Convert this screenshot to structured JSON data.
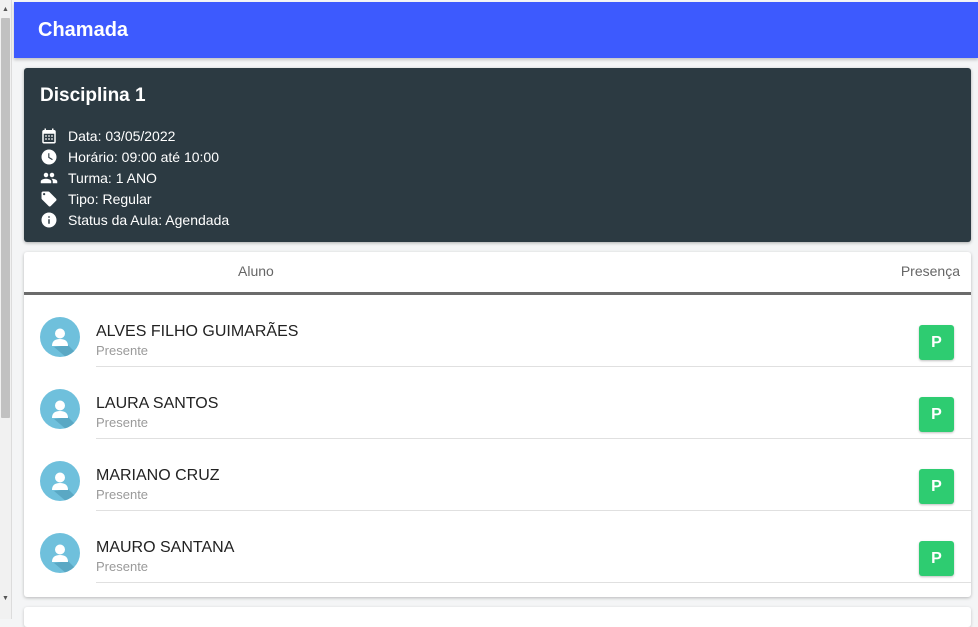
{
  "app": {
    "title": "Chamada"
  },
  "class_info": {
    "title": "Disciplina 1",
    "details": [
      {
        "icon": "calendar-icon",
        "text": "Data: 03/05/2022"
      },
      {
        "icon": "clock-icon",
        "text": "Horário: 09:00 até 10:00"
      },
      {
        "icon": "people-icon",
        "text": "Turma: 1 ANO"
      },
      {
        "icon": "tag-icon",
        "text": "Tipo: Regular"
      },
      {
        "icon": "info-icon",
        "text": "Status da Aula: Agendada"
      }
    ]
  },
  "table": {
    "headers": {
      "student": "Aluno",
      "presence": "Presença"
    },
    "rows": [
      {
        "name": "ALVES FILHO GUIMARÃES",
        "status": "Presente",
        "button": "P"
      },
      {
        "name": "LAURA SANTOS",
        "status": "Presente",
        "button": "P"
      },
      {
        "name": "MARIANO CRUZ",
        "status": "Presente",
        "button": "P"
      },
      {
        "name": "MAURO SANTANA",
        "status": "Presente",
        "button": "P"
      }
    ]
  },
  "colors": {
    "appbar": "#3d5afe",
    "info_card": "#2c3a42",
    "present_button": "#2ecc71",
    "avatar": "#6fc0dc"
  }
}
